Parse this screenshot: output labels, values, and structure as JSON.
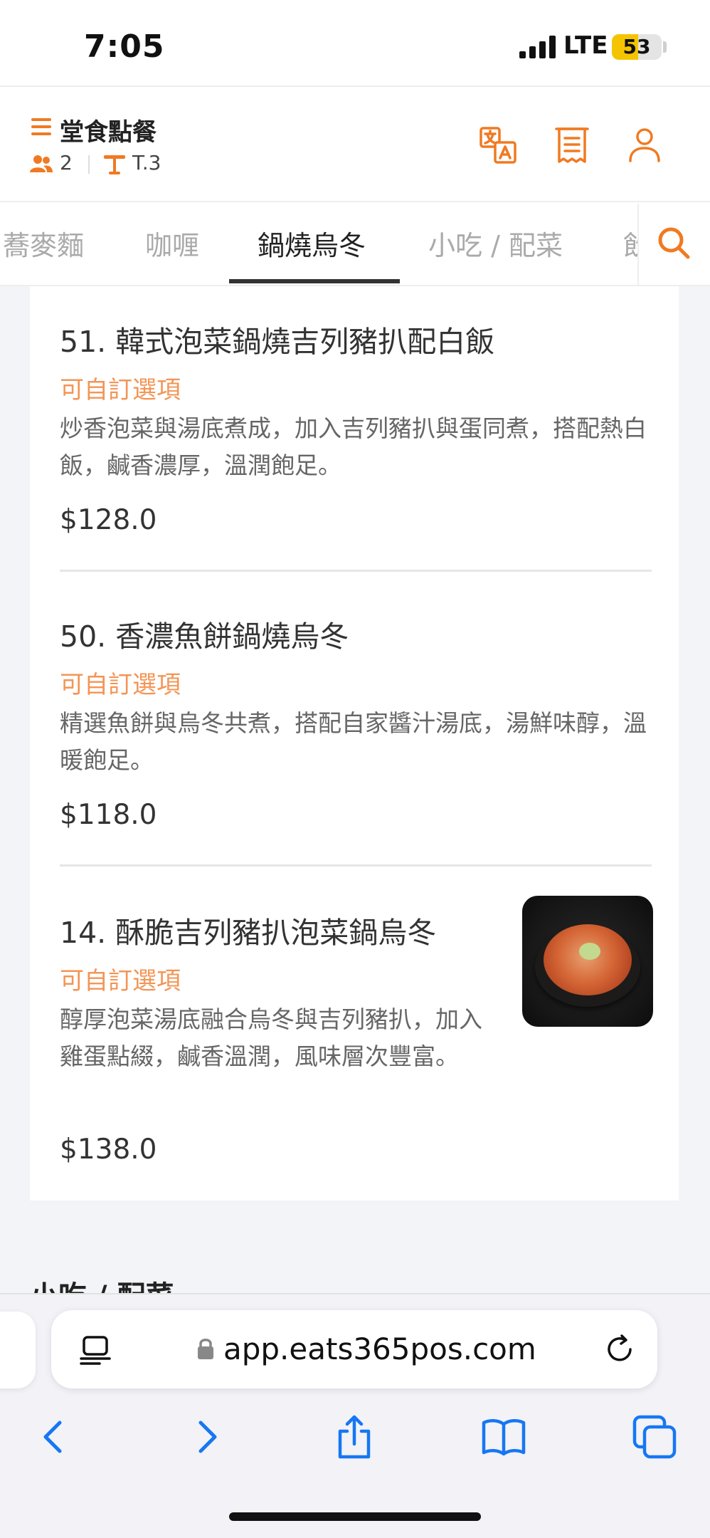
{
  "status_bar": {
    "time": "7:05",
    "network": "LTE",
    "battery": "53",
    "battery_level": 0.53
  },
  "header": {
    "title": "堂食點餐",
    "guest_count": "2",
    "table": "T.3",
    "accent_color": "#f07a22"
  },
  "category_tabs": {
    "items": [
      "蕎麥麵",
      "咖喱",
      "鍋燒烏冬",
      "小吃 / 配菜",
      "飲"
    ],
    "active": "鍋燒烏冬"
  },
  "menu_items": [
    {
      "title": "51. 韓式泡菜鍋燒吉列豬扒配白飯",
      "tag": "可自訂選項",
      "description": "炒香泡菜與湯底煮成，加入吉列豬扒與蛋同煮，搭配熱白飯，鹹香濃厚，溫潤飽足。",
      "price": "$128.0"
    },
    {
      "title": "50. 香濃魚餅鍋燒烏冬",
      "tag": "可自訂選項",
      "description": "精選魚餅與烏冬共煮，搭配自家醬汁湯底，湯鮮味醇，溫暖飽足。",
      "price": "$118.0"
    },
    {
      "title": "14. 酥脆吉列豬扒泡菜鍋烏冬",
      "tag": "可自訂選項",
      "description": "醇厚泡菜湯底融合烏冬與吉列豬扒，加入雞蛋點綴，鹹香溫潤，風味層次豐富。",
      "price": "$138.0"
    }
  ],
  "next_section": {
    "title": "小吃 / 配菜"
  },
  "browser": {
    "url": "app.eats365pos.com"
  },
  "icons": {
    "menu": "hamburger-icon",
    "guests": "people-icon",
    "table": "table-icon",
    "translate": "translate-icon",
    "receipt": "receipt-icon",
    "account": "account-icon",
    "search": "search-icon"
  }
}
